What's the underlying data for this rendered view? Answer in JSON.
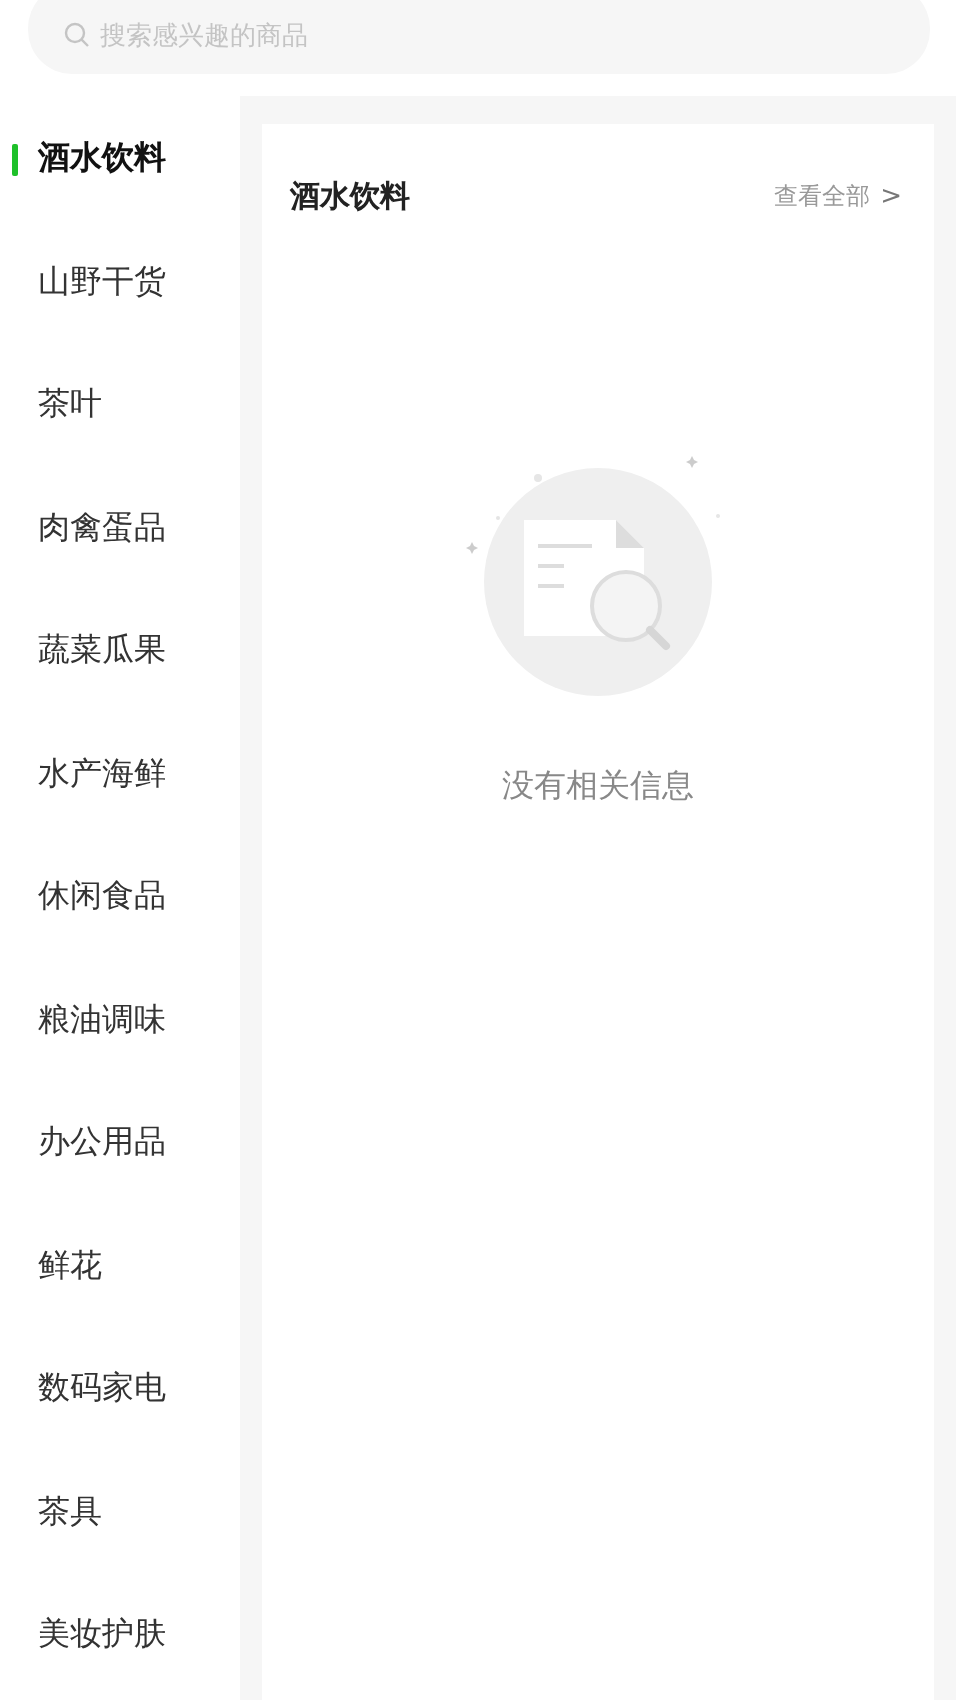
{
  "search": {
    "placeholder": "搜索感兴趣的商品"
  },
  "categories": [
    {
      "label": "酒水饮料",
      "selected": true
    },
    {
      "label": "山野干货",
      "selected": false
    },
    {
      "label": "茶叶",
      "selected": false
    },
    {
      "label": "肉禽蛋品",
      "selected": false
    },
    {
      "label": "蔬菜瓜果",
      "selected": false
    },
    {
      "label": "水产海鲜",
      "selected": false
    },
    {
      "label": "休闲食品",
      "selected": false
    },
    {
      "label": "粮油调味",
      "selected": false
    },
    {
      "label": "办公用品",
      "selected": false
    },
    {
      "label": "鲜花",
      "selected": false
    },
    {
      "label": "数码家电",
      "selected": false
    },
    {
      "label": "茶具",
      "selected": false
    },
    {
      "label": "美妆护肤",
      "selected": false
    }
  ],
  "panel": {
    "title": "酒水饮料",
    "view_all": "查看全部",
    "chevron": ">",
    "empty_message": "没有相关信息"
  }
}
